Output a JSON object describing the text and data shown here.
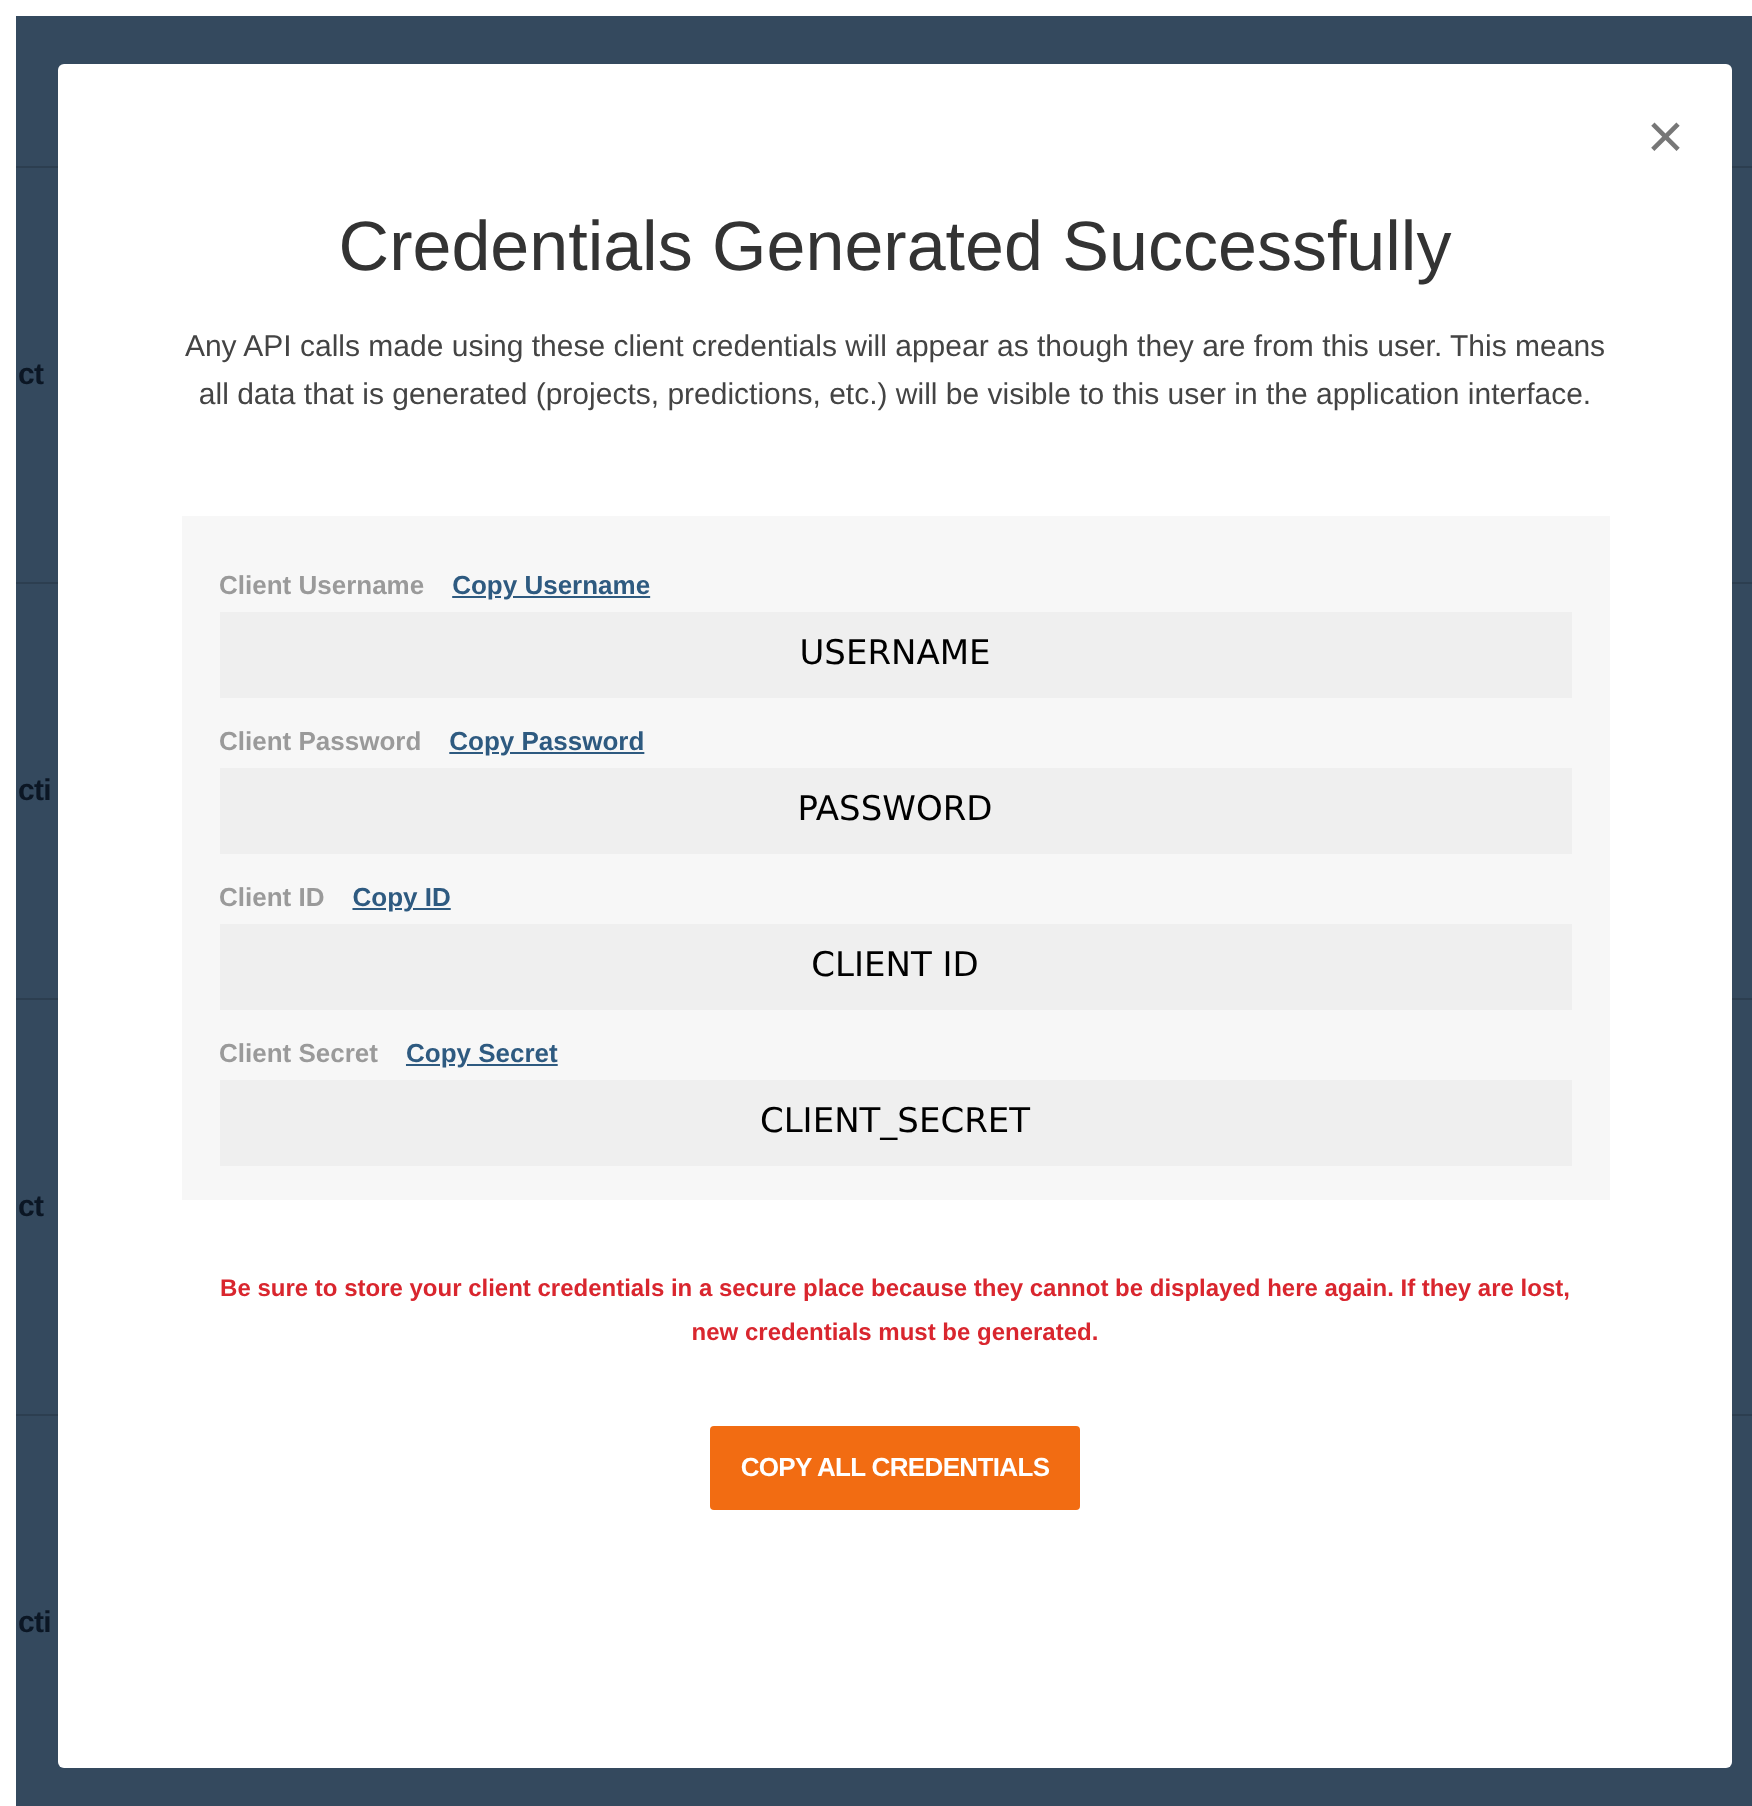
{
  "background_rows": [
    {
      "text": "ct"
    },
    {
      "text": "cti"
    },
    {
      "text": "ct"
    },
    {
      "text": "cti"
    }
  ],
  "modal": {
    "close": "×",
    "title": "Credentials Generated Successfully",
    "description": "Any API calls made using these client credentials will appear as though they are from this user. This means all data that is generated (projects, predictions, etc.) will be visible to this user in the application interface.",
    "credentials": [
      {
        "label": "Client Username",
        "copy_link": "Copy Username",
        "value": "USERNAME"
      },
      {
        "label": "Client Password",
        "copy_link": "Copy Password",
        "value": "PASSWORD"
      },
      {
        "label": "Client ID",
        "copy_link": "Copy ID",
        "value": "CLIENT ID"
      },
      {
        "label": "Client Secret",
        "copy_link": "Copy Secret",
        "value": "CLIENT_SECRET"
      }
    ],
    "warning": "Be sure to store your client credentials in a secure place because they cannot be displayed here again. If they are lost, new credentials must be generated.",
    "button": "COPY ALL CREDENTIALS"
  }
}
